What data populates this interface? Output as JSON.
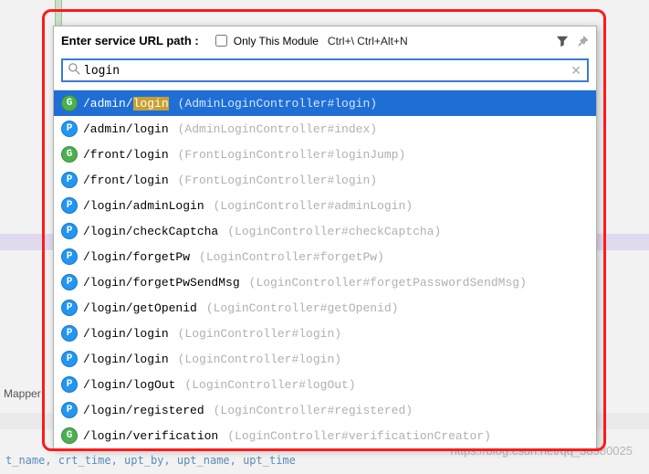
{
  "header": {
    "prompt": "Enter service URL path :",
    "checkbox_label": "Only This Module",
    "shortcut": "Ctrl+\\ Ctrl+Alt+N"
  },
  "search": {
    "value": "login",
    "placeholder": ""
  },
  "results": [
    {
      "method": "G",
      "path_pre": "/admin/",
      "path_hl": "login",
      "path_post": "",
      "controller": "(AdminLoginController#login)",
      "selected": true
    },
    {
      "method": "P",
      "path_pre": "/admin/login",
      "path_hl": "",
      "path_post": "",
      "controller": "(AdminLoginController#index)",
      "selected": false
    },
    {
      "method": "G",
      "path_pre": "/front/login",
      "path_hl": "",
      "path_post": "",
      "controller": "(FrontLoginController#loginJump)",
      "selected": false
    },
    {
      "method": "P",
      "path_pre": "/front/login",
      "path_hl": "",
      "path_post": "",
      "controller": "(FrontLoginController#login)",
      "selected": false
    },
    {
      "method": "P",
      "path_pre": "/login/adminLogin",
      "path_hl": "",
      "path_post": "",
      "controller": "(LoginController#adminLogin)",
      "selected": false
    },
    {
      "method": "P",
      "path_pre": "/login/checkCaptcha",
      "path_hl": "",
      "path_post": "",
      "controller": "(LoginController#checkCaptcha)",
      "selected": false
    },
    {
      "method": "P",
      "path_pre": "/login/forgetPw",
      "path_hl": "",
      "path_post": "",
      "controller": "(LoginController#forgetPw)",
      "selected": false
    },
    {
      "method": "P",
      "path_pre": "/login/forgetPwSendMsg",
      "path_hl": "",
      "path_post": "",
      "controller": "(LoginController#forgetPasswordSendMsg)",
      "selected": false
    },
    {
      "method": "P",
      "path_pre": "/login/getOpenid",
      "path_hl": "",
      "path_post": "",
      "controller": "(LoginController#getOpenid)",
      "selected": false
    },
    {
      "method": "P",
      "path_pre": "/login/login",
      "path_hl": "",
      "path_post": "",
      "controller": "(LoginController#login)",
      "selected": false
    },
    {
      "method": "P",
      "path_pre": "/login/login",
      "path_hl": "",
      "path_post": "",
      "controller": "(LoginController#login)",
      "selected": false
    },
    {
      "method": "P",
      "path_pre": "/login/logOut",
      "path_hl": "",
      "path_post": "",
      "controller": "(LoginController#logOut)",
      "selected": false
    },
    {
      "method": "P",
      "path_pre": "/login/registered",
      "path_hl": "",
      "path_post": "",
      "controller": "(LoginController#registered)",
      "selected": false
    },
    {
      "method": "G",
      "path_pre": "/login/verification",
      "path_hl": "",
      "path_post": "",
      "controller": "(LoginController#verificationCreator)",
      "selected": false
    }
  ],
  "background": {
    "mapper_label": "Mapper",
    "bottom_text": "t_name, crt_time, upt_by, upt_name, upt_time",
    "watermark": "https://blog.csdn.net/qq_38380025"
  }
}
